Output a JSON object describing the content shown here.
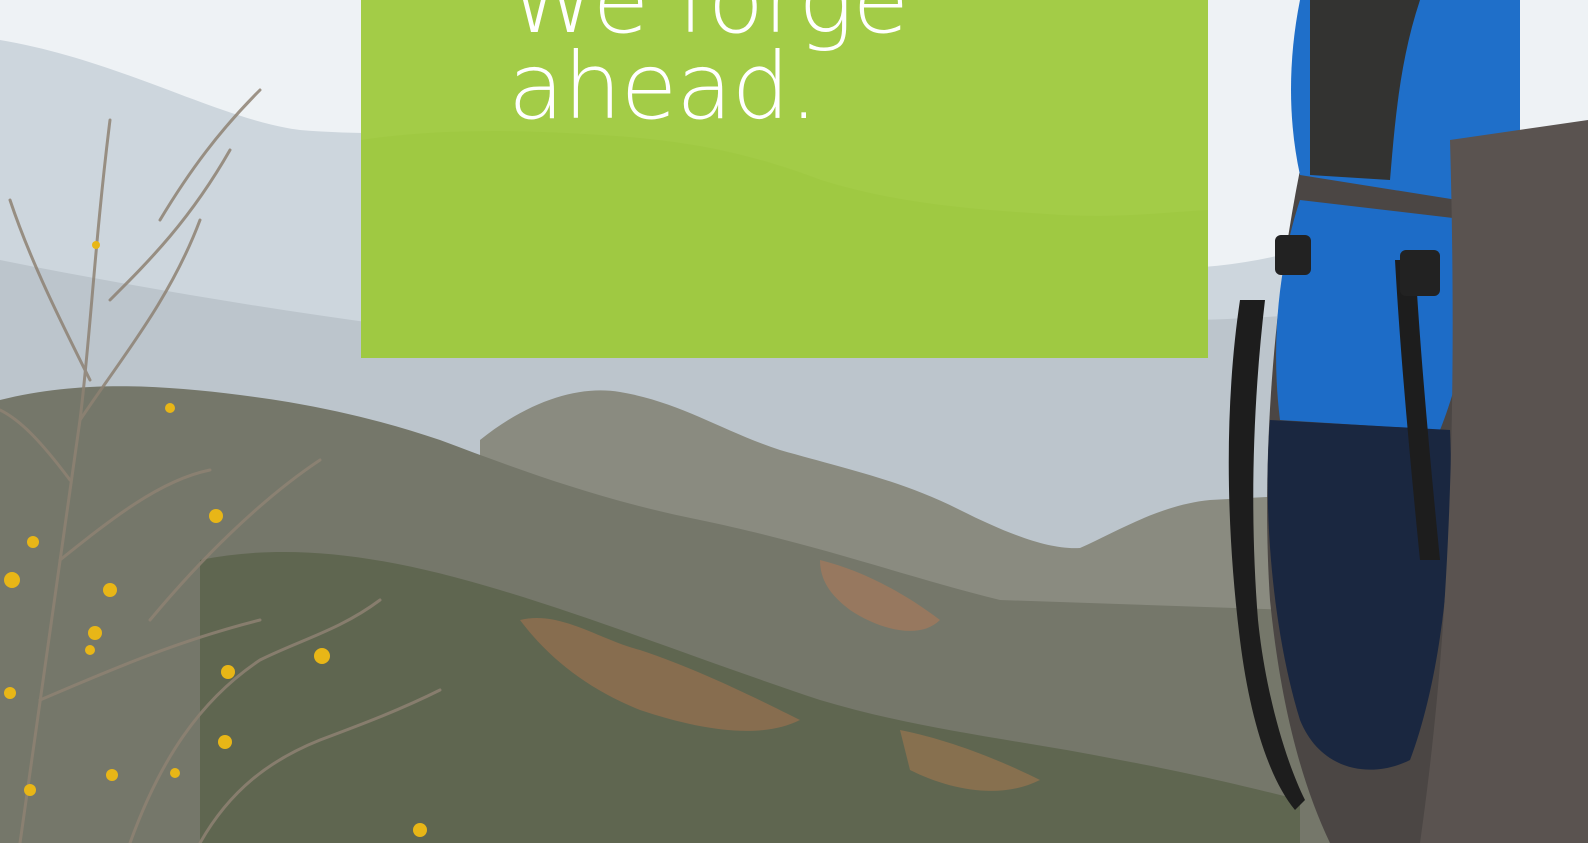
{
  "hero": {
    "headline_lines": [
      "We forge",
      "ahead."
    ]
  },
  "colors": {
    "panel_green": "#a3cc47",
    "sky": "#eef2f5",
    "mountain_far": "#c7d0d8",
    "mountain_mid": "#7b7a70",
    "mountain_near": "#5f6650",
    "backpack_blue": "#1f6fc9",
    "backpack_dark": "#2b2b2b",
    "blossom_yellow": "#e8b617"
  },
  "icons": {
    "backpack": "backpack-illustration",
    "branches": "tree-branches-illustration"
  }
}
